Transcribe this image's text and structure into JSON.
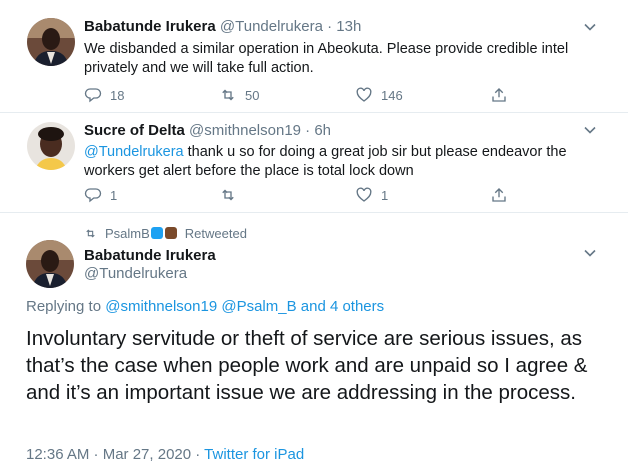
{
  "tweets": [
    {
      "author": "Babatunde Irukera",
      "handle": "@Tundelrukera",
      "time": "13h",
      "text": "We disbanded a similar operation in Abeokuta. Please provide credible intel privately and we will take full action.",
      "replies": "18",
      "retweets": "50",
      "likes": "146"
    },
    {
      "author": "Sucre of Delta",
      "handle": "@smithnelson19",
      "time": "6h",
      "mention": "@Tundelrukera",
      "text": " thank u so for doing a great job sir but please endeavor the workers get alert before the place is total lock down",
      "replies": "1",
      "likes": "1"
    }
  ],
  "retweet_context": {
    "by": "PsalmB",
    "label": "Retweeted"
  },
  "focused_tweet": {
    "author": "Babatunde Irukera",
    "handle": "@Tundelrukera",
    "replying_prefix": "Replying to ",
    "replying_to": "@smithnelson19 @Psalm_B and 4 others",
    "text": "Involuntary servitude or theft of service are serious issues, as that’s the case when people work and are unpaid so I agree & and it’s an important issue we are addressing in the process.",
    "timestamp": "12:36 AM · Mar 27, 2020 · ",
    "source": "Twitter for iPad"
  },
  "colors": {
    "link": "#1b95e0",
    "secondary": "#657786",
    "border": "#e6ecf0"
  },
  "icons": [
    "reply-icon",
    "retweet-icon",
    "like-icon",
    "share-icon",
    "chevron-down-icon"
  ]
}
